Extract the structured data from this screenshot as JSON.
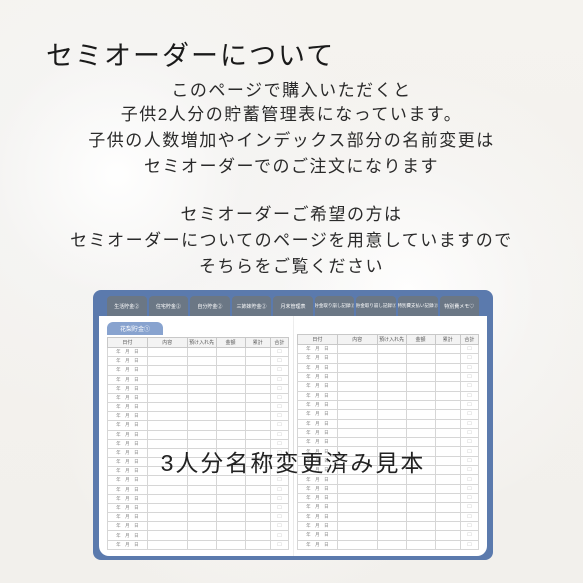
{
  "title": "セミオーダーについて",
  "lines": {
    "l1": "このページで購入いただくと",
    "l2": "子供2人分の貯蓄管理表になっています。",
    "l3": "子供の人数増加やインデックス部分の名前変更は",
    "l4": "セミオーダーでのご注文になります",
    "l5": "セミオーダーご希望の方は",
    "l6": "セミオーダーについてのページを用意していますので",
    "l7": "そちらをご覧ください"
  },
  "notebook": {
    "tabs": [
      "生活貯金②",
      "住宅貯金②",
      "自分貯金②",
      "三姉妹貯金②",
      "月末管理表",
      "貯金取り崩し記録②",
      "貯金取り崩し記録②",
      "特別費支払い記録②",
      "特別費メモ♡"
    ],
    "subtab": "花梨貯金①",
    "columns": [
      "日付",
      "内容",
      "預け入れ先",
      "金額",
      "累計",
      "合計"
    ],
    "date_cell": "年　月　日",
    "check": "☐",
    "rows": 22
  },
  "overlay": "3人分名称変更済み見本"
}
